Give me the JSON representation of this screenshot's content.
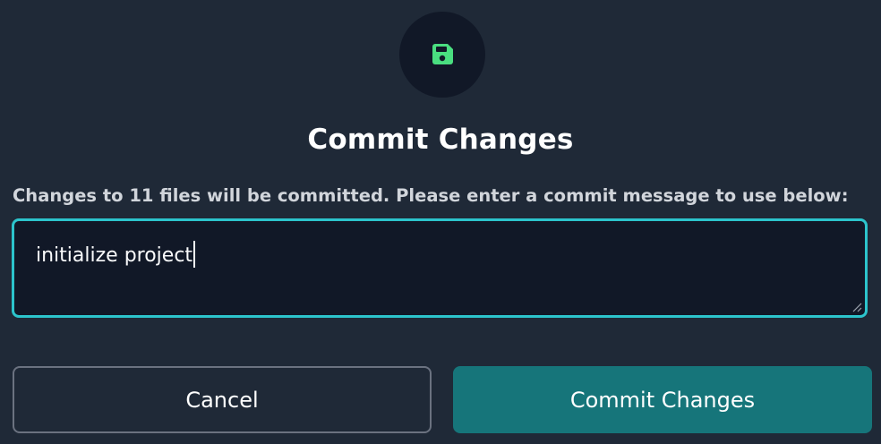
{
  "dialog": {
    "icon": "save-icon",
    "icon_color": "#4ade80",
    "accent_color": "#2cc4cc",
    "title": "Commit Changes",
    "prompt": "Changes to 11 files will be committed. Please enter a commit message to use below:",
    "message_value": "initialize project",
    "cancel_label": "Cancel",
    "commit_label": "Commit Changes",
    "commit_button_color": "#16757a"
  }
}
